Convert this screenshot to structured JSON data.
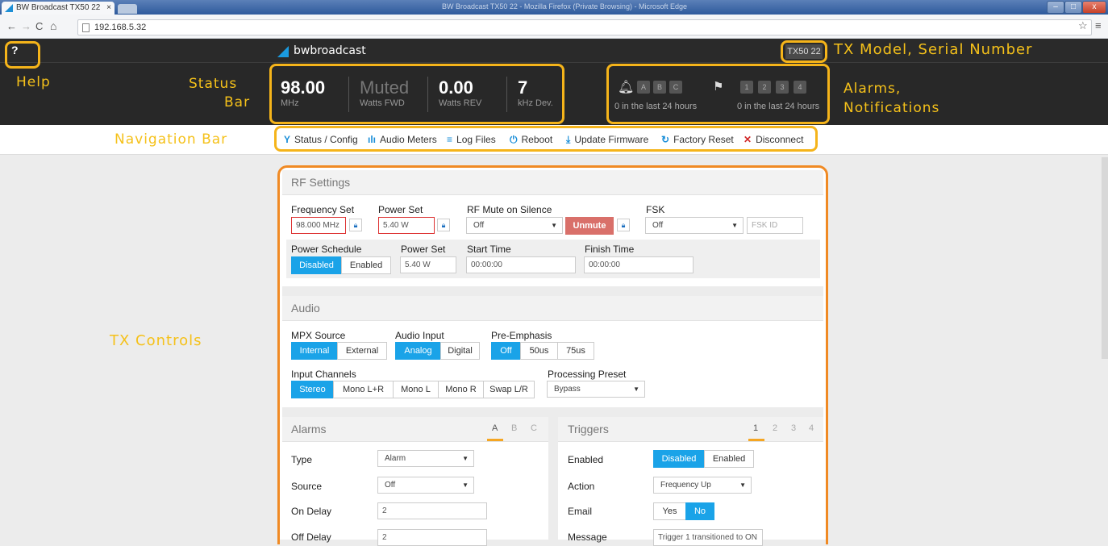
{
  "browser": {
    "tab_title": "BW Broadcast TX50 22",
    "tab_close": "×",
    "window_title": "BW Broadcast TX50 22 - Mozilla Firefox (Private Browsing) - Microsoft Edge",
    "url": "192.168.5.32",
    "minimize": "–",
    "maximize": "□",
    "close": "x"
  },
  "header": {
    "help": "?",
    "brand": "bwbroadcast",
    "model_serial": "TX50 22"
  },
  "status": {
    "freq_value": "98.00",
    "freq_unit": "MHz",
    "fwd_value": "Muted",
    "fwd_unit": "Watts FWD",
    "rev_value": "0.00",
    "rev_unit": "Watts REV",
    "dev_value": "7",
    "dev_unit": "kHz Dev."
  },
  "alarms": {
    "badges": [
      "A",
      "B",
      "C"
    ],
    "text": "0 in the last 24 hours"
  },
  "notifications": {
    "badges": [
      "1",
      "2",
      "3",
      "4"
    ],
    "text": "0 in the last 24 hours"
  },
  "callouts": {
    "tx_model": "TX Model, Serial Number",
    "help": "Help",
    "status_bar_1": "Status",
    "status_bar_2": "Bar",
    "alarms_1": "Alarms,",
    "alarms_2": "Notifications",
    "navigation_bar": "Navigation Bar",
    "tx_controls": "TX Controls"
  },
  "nav": [
    {
      "icon": "Y",
      "label": "Status / Config"
    },
    {
      "icon": "ılı",
      "label": "Audio Meters"
    },
    {
      "icon": "≡",
      "label": "Log Files"
    },
    {
      "icon": "⏻",
      "label": "Reboot"
    },
    {
      "icon": "⤓",
      "label": "Update Firmware"
    },
    {
      "icon": "↻",
      "label": "Factory Reset"
    },
    {
      "icon": "✕",
      "label": "Disconnect"
    }
  ],
  "rf": {
    "title": "RF Settings",
    "freq_label": "Frequency Set",
    "freq_value": "98.000 MHz",
    "power_label": "Power Set",
    "power_value": "5.40 W",
    "mute_label": "RF Mute on Silence",
    "mute_value": "Off",
    "unmute": "Unmute",
    "fsk_label": "FSK",
    "fsk_value": "Off",
    "fsk_id_placeholder": "FSK ID",
    "sched_label": "Power Schedule",
    "sched_disabled": "Disabled",
    "sched_enabled": "Enabled",
    "sched_power_label": "Power Set",
    "sched_power_value": "5.40 W",
    "start_label": "Start Time",
    "start_value": "00:00:00",
    "finish_label": "Finish Time",
    "finish_value": "00:00:00"
  },
  "audio": {
    "title": "Audio",
    "mpx_label": "MPX Source",
    "mpx_internal": "Internal",
    "mpx_external": "External",
    "input_label": "Audio Input",
    "input_analog": "Analog",
    "input_digital": "Digital",
    "pre_label": "Pre-Emphasis",
    "pre_off": "Off",
    "pre_50": "50us",
    "pre_75": "75us",
    "channels_label": "Input Channels",
    "ch_stereo": "Stereo",
    "ch_monolr": "Mono L+R",
    "ch_monol": "Mono L",
    "ch_monor": "Mono R",
    "ch_swap": "Swap L/R",
    "preset_label": "Processing Preset",
    "preset_value": "Bypass"
  },
  "alarms_panel": {
    "title": "Alarms",
    "tabs": [
      "A",
      "B",
      "C"
    ],
    "type_label": "Type",
    "type_value": "Alarm",
    "source_label": "Source",
    "source_value": "Off",
    "on_delay_label": "On Delay",
    "on_delay_value": "2",
    "off_delay_label": "Off Delay",
    "off_delay_value": "2"
  },
  "triggers_panel": {
    "title": "Triggers",
    "tabs": [
      "1",
      "2",
      "3",
      "4"
    ],
    "enabled_label": "Enabled",
    "disabled_btn": "Disabled",
    "enabled_btn": "Enabled",
    "action_label": "Action",
    "action_value": "Frequency Up",
    "email_label": "Email",
    "email_yes": "Yes",
    "email_no": "No",
    "message_label": "Message",
    "message_value": "Trigger 1 transitioned to ON"
  },
  "colors": {
    "accent": "#1aa3e8",
    "callout": "#f5b41a",
    "controls_outline": "#f08a24",
    "header_bg": "#282828",
    "unmute": "#d9706a"
  }
}
